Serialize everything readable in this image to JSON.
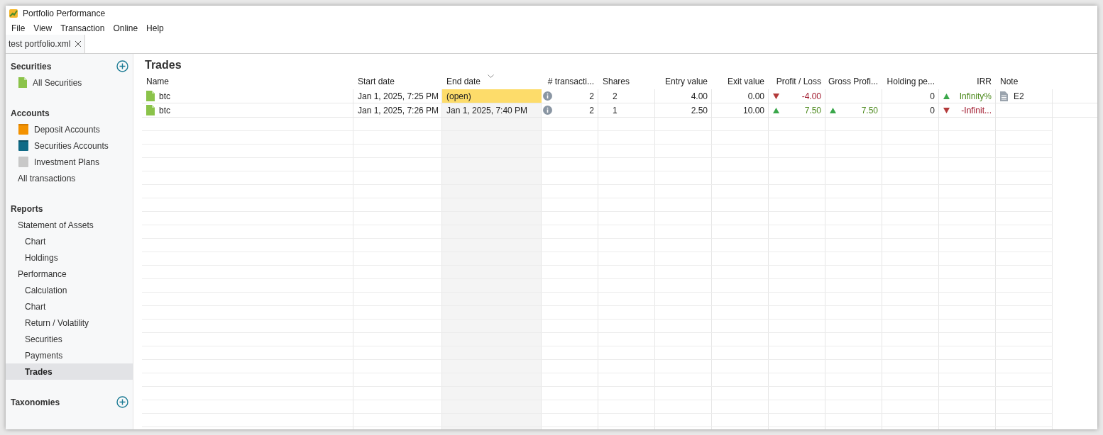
{
  "window": {
    "title": "Portfolio Performance"
  },
  "menu": [
    "File",
    "View",
    "Transaction",
    "Online",
    "Help"
  ],
  "tabs": [
    {
      "label": "test portfolio.xml",
      "selected": true
    }
  ],
  "sidebar": [
    {
      "title": "Securities",
      "add_button": true,
      "items": [
        {
          "label": "All Securities",
          "kind": "security",
          "selected": false
        }
      ]
    },
    {
      "title": "Accounts",
      "items": [
        {
          "label": "Deposit Accounts",
          "kind": "deposit",
          "selected": false
        },
        {
          "label": "Securities Accounts",
          "kind": "account",
          "selected": false
        },
        {
          "label": "Investment Plans",
          "kind": "plan",
          "selected": false
        },
        {
          "label": "All transactions",
          "selected": false
        }
      ]
    },
    {
      "title": "Reports",
      "items": [
        {
          "label": "Statement of Assets",
          "selected": false,
          "children": [
            {
              "label": "Chart",
              "selected": false
            },
            {
              "label": "Holdings",
              "selected": false
            }
          ]
        },
        {
          "label": "Performance",
          "selected": false,
          "children": [
            {
              "label": "Calculation",
              "selected": false
            },
            {
              "label": "Chart",
              "selected": false
            },
            {
              "label": "Return / Volatility",
              "selected": false
            },
            {
              "label": "Securities",
              "selected": false
            },
            {
              "label": "Payments",
              "selected": false
            },
            {
              "label": "Trades",
              "selected": true
            }
          ]
        }
      ]
    },
    {
      "title": "Taxonomies",
      "add_button": true
    }
  ],
  "page_title": "Trades",
  "table": {
    "columns": [
      {
        "label": "Name"
      },
      {
        "label": "Start date"
      },
      {
        "label": "End date",
        "sorted": true
      },
      {
        "label": "# transacti..."
      },
      {
        "label": "Shares"
      },
      {
        "label": "Entry value"
      },
      {
        "label": "Exit value"
      },
      {
        "label": "Profit / Loss"
      },
      {
        "label": "Gross Profi..."
      },
      {
        "label": "Holding pe..."
      },
      {
        "label": "IRR"
      },
      {
        "label": "Note"
      }
    ],
    "rows": [
      {
        "name": "btc",
        "start_date": "Jan 1, 2025, 7:25 PM",
        "end_date": "(open)",
        "open": true,
        "transactions": "2",
        "shares": "2",
        "entry_value": "4.00",
        "exit_value": "0.00",
        "profit_loss": {
          "value": "-4.00",
          "kind": "down"
        },
        "holding_period": "0",
        "irr": {
          "value": "Infinity%",
          "kind": "up"
        },
        "note": "E2"
      },
      {
        "name": "btc",
        "start_date": "Jan 1, 2025, 7:26 PM",
        "end_date": "Jan 1, 2025, 7:40 PM",
        "open": false,
        "transactions": "2",
        "shares": "1",
        "entry_value": "2.50",
        "exit_value": "10.00",
        "profit_loss": {
          "value": "7.50",
          "kind": "up"
        },
        "gross_profit": {
          "value": "7.50",
          "kind": "up"
        },
        "holding_period": "0",
        "irr": {
          "value": "-Infinit...",
          "kind": "down"
        }
      }
    ]
  }
}
